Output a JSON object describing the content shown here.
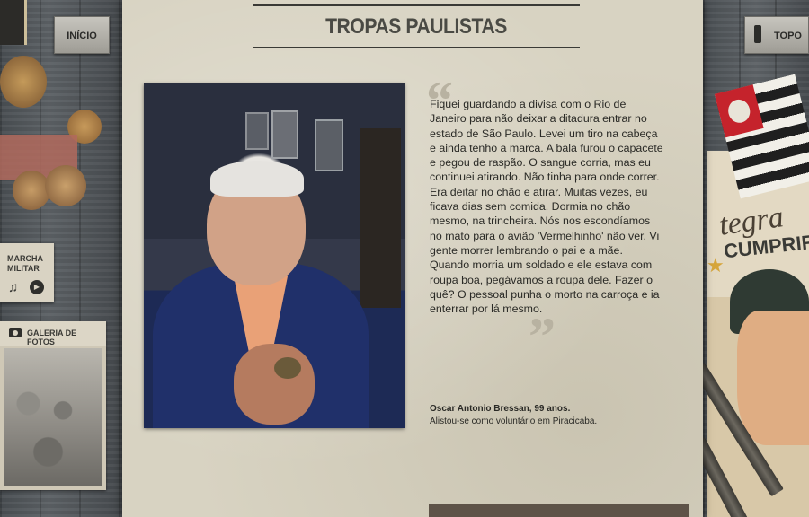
{
  "header": {
    "title": "TROPAS PAULISTAS"
  },
  "nav": {
    "inicio_label": "INÍCIO",
    "topo_label": "TOPO"
  },
  "sidebar": {
    "marcha_label": "MARCHA MILITAR",
    "galeria_label": "GALERIA DE FOTOS"
  },
  "testimony": {
    "quote": "Fiquei guardando a divisa com o Rio de Janeiro para não deixar a ditadura entrar no estado de São Paulo. Levei um tiro na cabeça e ainda tenho a marca. A bala furou o capacete e pegou de raspão. O sangue corria, mas eu continuei atirando. Não tinha para onde correr. Era deitar no chão e atirar. Muitas vezes, eu ficava dias sem comida. Dormia no chão mesmo, na trincheira. Nós nos escondíamos no mato para o avião 'Vermelhinho' não ver. Vi gente morrer lembrando o pai e a mãe. Quando morria um soldado e ele estava com roupa boa, pegávamos a roupa dele. Fazer o quê? O pessoal punha o morto na carroça e ia enterrar por lá mesmo.",
    "quote_open_mark": "“",
    "quote_close_mark": "”",
    "credit_name": "Oscar Antonio Bressan, 99 anos.",
    "credit_desc": "Alistou-se como voluntário em Piracicaba."
  },
  "poster": {
    "word1": "tegra",
    "word2": "CUMPRIR"
  },
  "icons": {
    "note": "music-note-icon",
    "play": "play-icon",
    "camera": "camera-icon",
    "topo": "topo-icon"
  },
  "colors": {
    "paper": "#d8d3c2",
    "wood": "#4a4f53",
    "text": "#2a2a26",
    "flag_red": "#c5232c"
  }
}
